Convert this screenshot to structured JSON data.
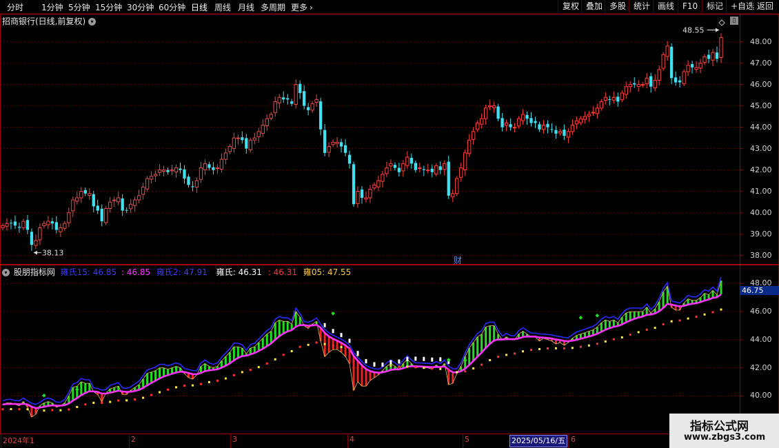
{
  "toolbar": {
    "periods": [
      "分时",
      "1分钟",
      "5分钟",
      "15分钟",
      "30分钟",
      "60分钟",
      "日线",
      "周线",
      "月线",
      "多周期",
      "更多"
    ],
    "active_period": "日线",
    "more_arrow": "›",
    "right_buttons": [
      "复权",
      "叠加",
      "多股",
      "统计",
      "画线",
      "F10",
      "标记",
      "+自选",
      "返回"
    ]
  },
  "main": {
    "title": "招商银行(日线,前复权)",
    "max_label": "48.55",
    "min_label": "38.13",
    "finance_marker": "财",
    "y_ticks": [
      48.0,
      47.0,
      46.0,
      45.0,
      44.0,
      43.0,
      42.0,
      41.0,
      40.0,
      39.0,
      38.0
    ]
  },
  "indicator": {
    "name": "股朋指标网",
    "legend": [
      {
        "label": "雍氏15: 46.85",
        "color": "#3a3aff"
      },
      {
        "label": ": 46.85",
        "color": "#ff33ff"
      },
      {
        "label": "雍氏2: 47.91",
        "color": "#3a3aff"
      },
      {
        "label": "雍氏: 46.31",
        "color": "#ffffff"
      },
      {
        "label": ": 46.31",
        "color": "#ff3333"
      },
      {
        "label": "雍05: 47.55",
        "color": "#ffcc33"
      }
    ],
    "y_ticks": [
      48.0,
      46.0,
      44.0,
      42.0,
      40.0
    ],
    "current_value": "46.75"
  },
  "date_axis": {
    "labels": [
      "2024年1",
      "2",
      "3",
      "4",
      "5",
      "6"
    ],
    "cursor_date": "2025/05/16/五"
  },
  "watermark": {
    "line1": "指标公式网",
    "line2": "www.zbgs3.com"
  },
  "colors": {
    "up": "#ff4040",
    "down": "#40e0f0",
    "ma_magenta": "#ff33ff",
    "envelope": "#2a2aff",
    "grid": "#7a0000"
  },
  "chart_data": {
    "type": "candlestick",
    "series_name": "",
    "close": [
      39.4,
      39.5,
      39.5,
      39.4,
      39.3,
      39.6,
      39.2,
      38.5,
      38.7,
      39.3,
      39.5,
      39.6,
      39.5,
      39.2,
      39.3,
      39.5,
      40.0,
      40.6,
      40.7,
      41.0,
      40.9,
      40.9,
      40.3,
      40.1,
      39.6,
      40.2,
      40.5,
      40.6,
      40.7,
      40.1,
      40.1,
      40.4,
      40.6,
      40.8,
      41.2,
      41.6,
      41.7,
      41.8,
      42.0,
      42.0,
      41.9,
      42.0,
      42.1,
      42.0,
      41.6,
      41.3,
      41.2,
      41.5,
      42.1,
      42.3,
      42.1,
      42.0,
      42.1,
      42.5,
      42.8,
      43.1,
      43.5,
      43.5,
      43.4,
      43.0,
      43.4,
      43.5,
      43.8,
      44.1,
      44.4,
      44.6,
      45.2,
      45.4,
      45.3,
      45.3,
      45.1,
      46.0,
      45.6,
      45.0,
      44.8,
      45.1,
      45.3,
      43.9,
      42.8,
      43.1,
      43.3,
      43.3,
      43.1,
      42.8,
      42.3,
      40.4,
      41.0,
      40.7,
      40.7,
      41.1,
      41.3,
      41.5,
      41.8,
      42.1,
      42.3,
      42.1,
      41.9,
      42.3,
      42.6,
      42.3,
      42.0,
      42.1,
      42.0,
      42.0,
      41.9,
      42.2,
      42.0,
      42.3,
      40.8,
      40.9,
      41.6,
      42.1,
      42.8,
      43.4,
      43.8,
      44.2,
      44.4,
      44.9,
      45.0,
      45.0,
      44.4,
      44.0,
      44.2,
      44.0,
      44.0,
      44.4,
      44.6,
      44.4,
      44.2,
      44.2,
      43.9,
      44.1,
      44.0,
      43.9,
      43.7,
      43.8,
      43.6,
      43.8,
      44.1,
      44.3,
      44.4,
      44.5,
      44.6,
      44.7,
      44.9,
      45.2,
      45.4,
      45.3,
      45.4,
      45.2,
      45.6,
      45.9,
      46.0,
      46.0,
      46.0,
      46.0,
      46.3,
      45.9,
      46.2,
      46.7,
      47.4,
      47.8,
      46.3,
      46.1,
      46.1,
      46.6,
      46.9,
      46.8,
      46.8,
      47.0,
      47.3,
      47.2,
      47.5,
      47.2,
      48.2
    ],
    "indicator_series": {
      "magenta_ma": "derived",
      "envelope_upper": "derived",
      "envelope_lower": "derived"
    },
    "ylim_main": [
      37.7,
      48.6
    ],
    "ylim_indicator": [
      38.6,
      48.7
    ],
    "grid": true
  }
}
